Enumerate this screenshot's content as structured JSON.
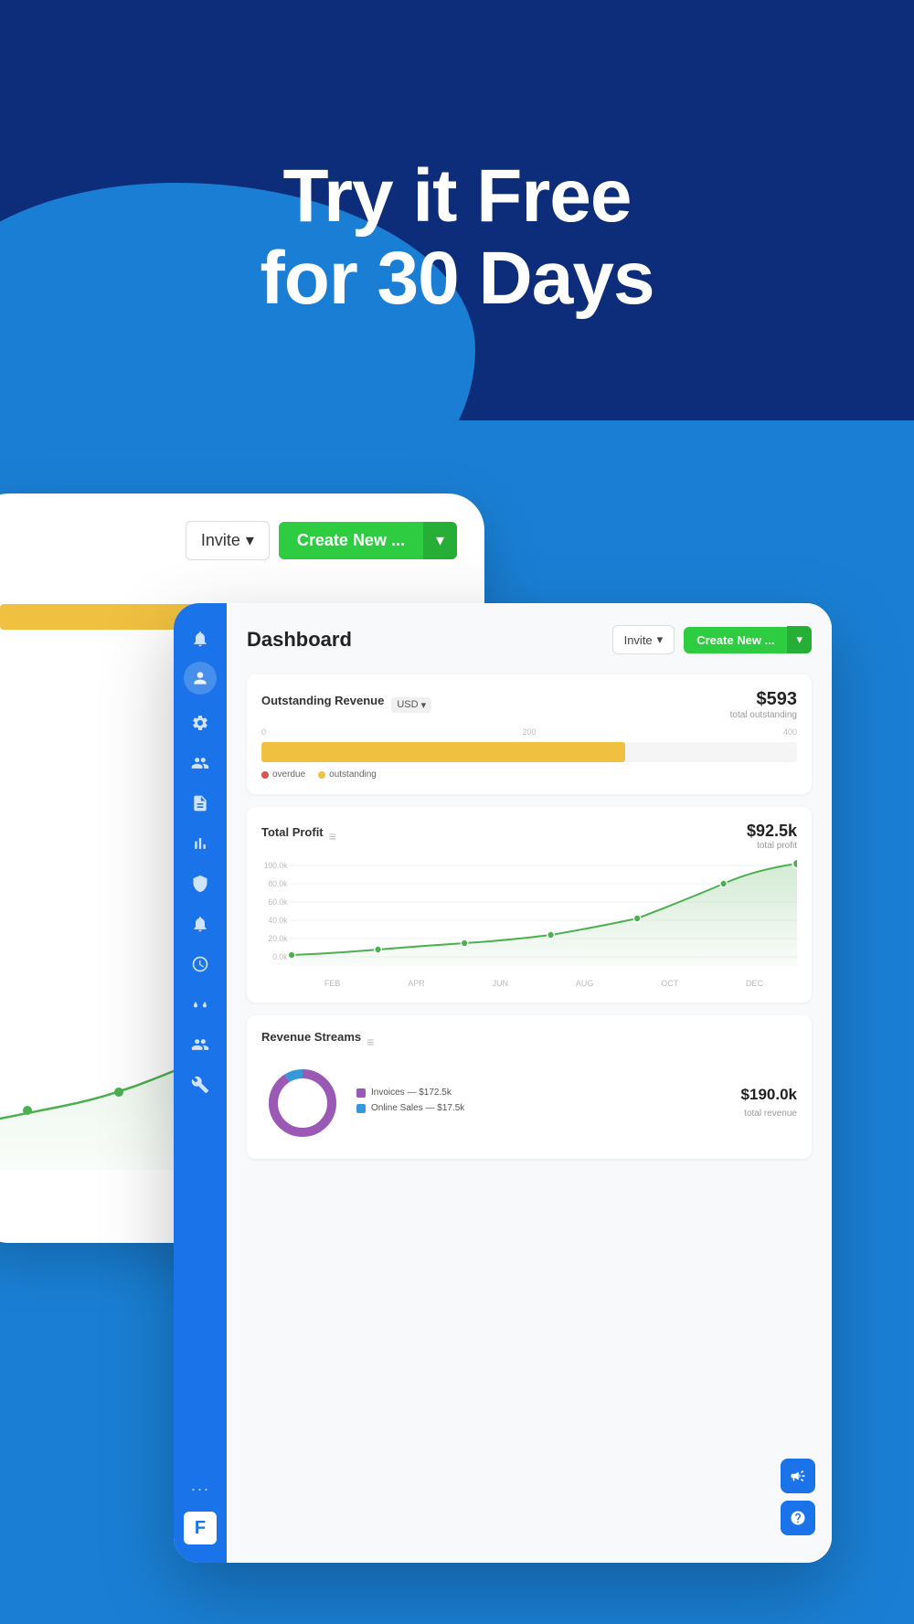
{
  "hero": {
    "line1": "Try it Free",
    "line2": "for 30 Days"
  },
  "back_card": {
    "invite_label": "Invite",
    "create_new_label": "Create New ...",
    "chevron": "▾"
  },
  "dashboard": {
    "title": "Dashboard",
    "invite_label": "Invite",
    "create_new_label": "Create New ...",
    "chevron": "▾",
    "outstanding_revenue": {
      "title": "Outstanding Revenue",
      "currency": "USD",
      "amount": "$593",
      "sub": "total outstanding",
      "scale": [
        "0",
        "200",
        "400"
      ],
      "bar_fill_pct": 68,
      "legend": [
        {
          "label": "overdue",
          "color": "#e05050"
        },
        {
          "label": "outstanding",
          "color": "#f0c040"
        }
      ]
    },
    "total_profit": {
      "title": "Total Profit",
      "amount": "$92.5k",
      "sub": "total profit",
      "y_labels": [
        "100.0k",
        "80.0k",
        "60.0k",
        "40.0k",
        "20.0k",
        "0.0k"
      ],
      "x_labels": [
        "FEB",
        "APR",
        "JUN",
        "AUG",
        "OCT",
        "DEC"
      ]
    },
    "revenue_streams": {
      "title": "Revenue Streams",
      "total_amount": "$190.0k",
      "sub": "total revenue",
      "legend": [
        {
          "label": "Invoices — $172.5k",
          "color": "#9b59b6"
        },
        {
          "label": "Online Sales — $17.5k",
          "color": "#3498db"
        }
      ],
      "donut": {
        "invoices_pct": 91,
        "online_pct": 9
      }
    }
  },
  "sidebar_icons": [
    "bell",
    "avatar",
    "gear",
    "users",
    "file",
    "chart",
    "shield",
    "bell2",
    "clock",
    "beaker",
    "team",
    "tools"
  ],
  "floating_buttons": [
    "megaphone",
    "question"
  ]
}
